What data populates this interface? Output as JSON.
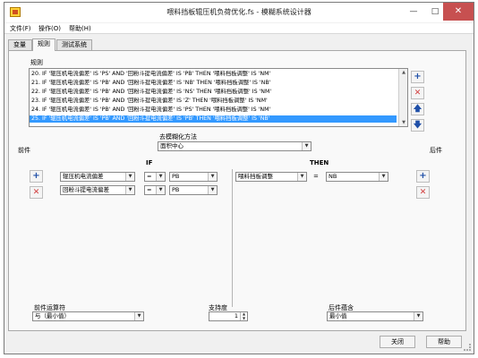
{
  "window": {
    "title": "喂料挡板辊压机负荷优化.fs - 模糊系统设计器"
  },
  "menu": {
    "file": "文件(F)",
    "edit": "操作(O)",
    "help": "帮助(H)"
  },
  "tabs": {
    "variables": "变量",
    "rules": "规则",
    "test": "测试系统"
  },
  "rules_section": {
    "label": "规则",
    "items": [
      "20. IF '辊压机电流偏差' IS 'PS' AND '回粉斗提电流偏差' IS 'PB' THEN '喂料挡板调整' IS 'NM'",
      "21. IF '辊压机电流偏差' IS 'PB' AND '回粉斗提电流偏差' IS 'NB' THEN '喂料挡板调整' IS 'NB'",
      "22. IF '辊压机电流偏差' IS 'PB' AND '回粉斗提电流偏差' IS 'NS' THEN '喂料挡板调整' IS 'NM'",
      "23. IF '辊压机电流偏差' IS 'PB' AND '回粉斗提电流偏差' IS 'Z' THEN '喂料挡板调整' IS 'NM'",
      "24. IF '辊压机电流偏差' IS 'PB' AND '回粉斗提电流偏差' IS 'PS' THEN '喂料挡板调整' IS 'NM'",
      "25. IF '辊压机电流偏差' IS 'PB' AND '回粉斗提电流偏差' IS 'PB' THEN '喂料挡板调整' IS 'NB'"
    ],
    "selected_index": 5
  },
  "defuzz": {
    "label": "去模糊化方法",
    "value": "面积中心"
  },
  "antecedent_label": "前件",
  "consequent_label": "后件",
  "if_label": "IF",
  "then_label": "THEN",
  "if_rows": [
    {
      "variable": "辊压机电流偏差",
      "op": "=",
      "term": "PB"
    },
    {
      "variable": "回粉斗提电流偏差",
      "op": "=",
      "term": "PB"
    }
  ],
  "then_rows": [
    {
      "variable": "喂料挡板调整",
      "op": "=",
      "term": "NB"
    }
  ],
  "antecedent_connective": {
    "label": "前件运算符",
    "value": "与（最小值）"
  },
  "support": {
    "label": "支持度",
    "value": "1"
  },
  "implication": {
    "label": "后件蕴含",
    "value": "最小值"
  },
  "buttons": {
    "close": "关闭",
    "help": "帮助"
  }
}
